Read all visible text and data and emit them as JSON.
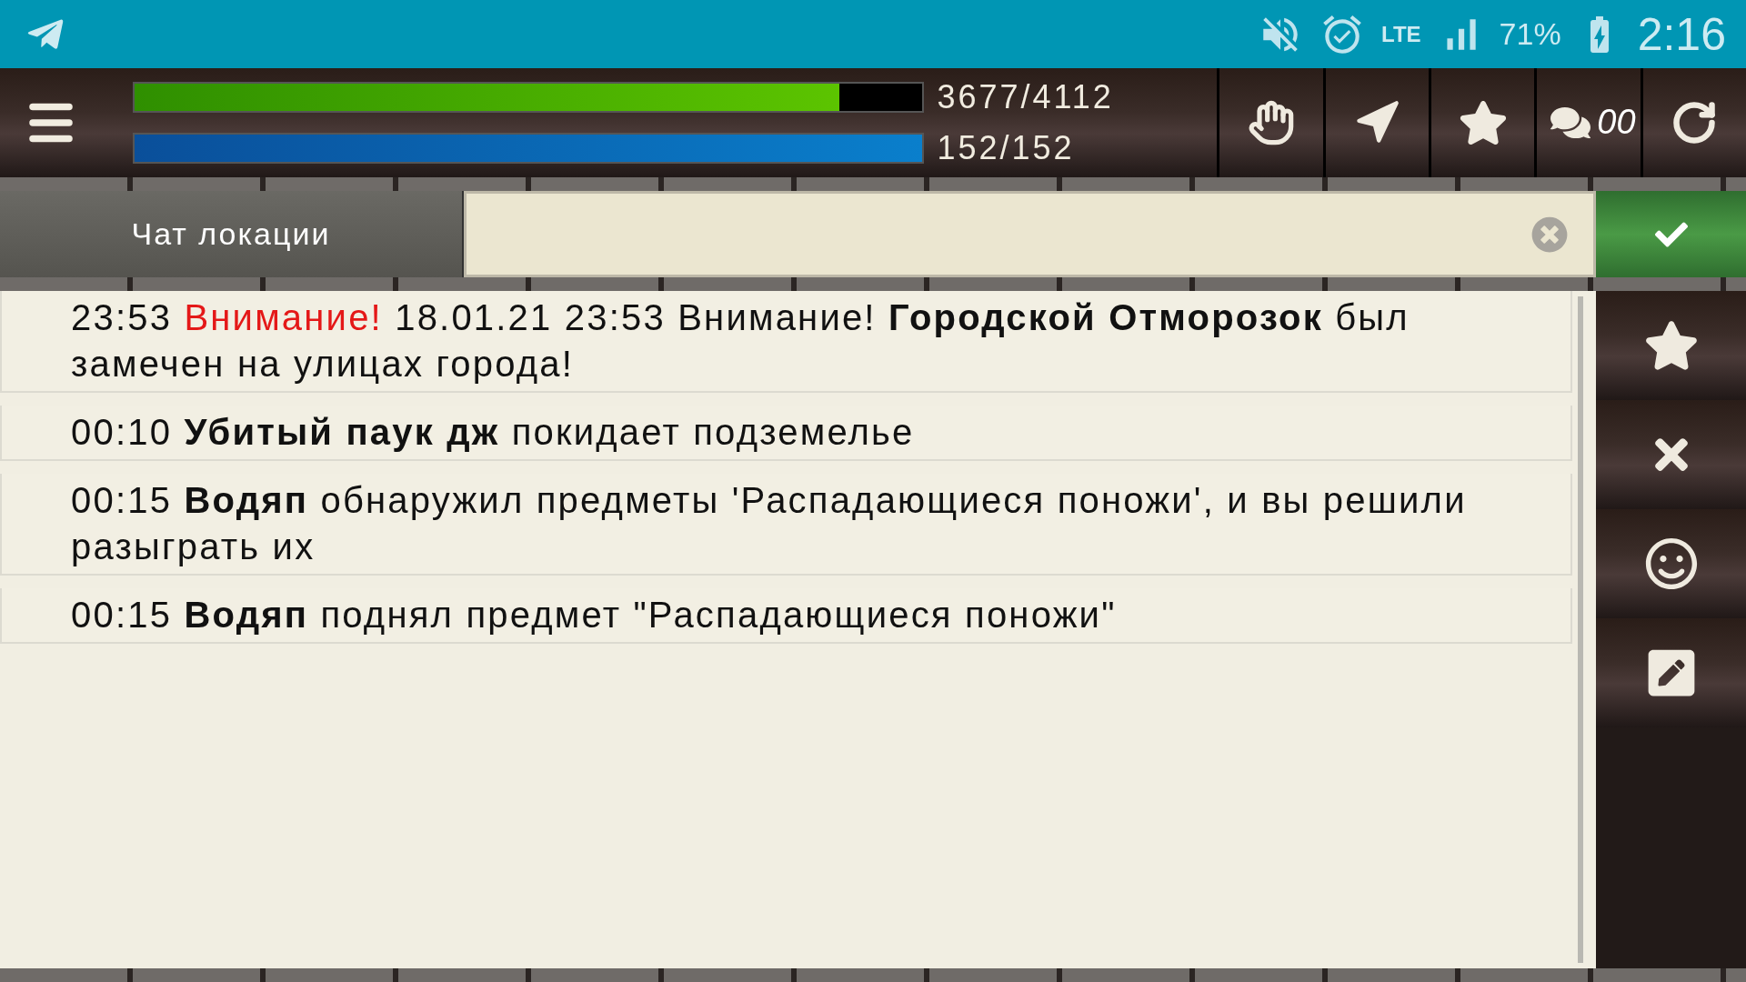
{
  "status_bar": {
    "network": "LTE",
    "battery": "71%",
    "time": "2:16"
  },
  "toolbar": {
    "health": {
      "level": 0.894,
      "reading": "3677/4112"
    },
    "mana": {
      "level": 1,
      "reading": "152/152"
    },
    "chat_badge": "00"
  },
  "chat": {
    "channel_tab": "Чат локации"
  },
  "messages": [
    {
      "time": "23:53",
      "parts": [
        {
          "kind": "alert",
          "text": "Внимание!"
        },
        {
          "kind": "text",
          "text": " 18.01.21 23:53 Внимание! "
        },
        {
          "kind": "bold",
          "text": "Городской Отморозок"
        },
        {
          "kind": "text",
          "text": " был замечен на улицах города!"
        }
      ]
    },
    {
      "time": "00:10",
      "parts": [
        {
          "kind": "bold",
          "text": "Убитый паук дж"
        },
        {
          "kind": "text",
          "text": " покидает подземелье"
        }
      ]
    },
    {
      "time": "00:15",
      "parts": [
        {
          "kind": "bold",
          "text": "Водяп"
        },
        {
          "kind": "text",
          "text": " обнаружил предметы 'Распадающиеся поножи', и вы решили разыграть их"
        }
      ]
    },
    {
      "time": "00:15",
      "parts": [
        {
          "kind": "bold",
          "text": "Водяп"
        },
        {
          "kind": "text",
          "text": " поднял предмет \"Распадающиеся поножи\""
        }
      ]
    }
  ]
}
